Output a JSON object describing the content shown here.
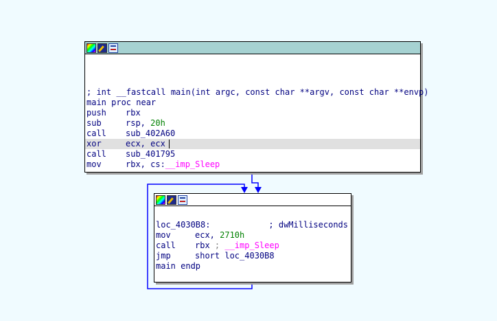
{
  "colors": {
    "background": "#f0fbff",
    "header_selected": "#a6d2d2",
    "edge": "#0000ff",
    "register": "#000080",
    "number": "#008000",
    "import": "#ff00ff",
    "comment": "#808080",
    "highlight": "#e0e0e0"
  },
  "header_icons": [
    "color-picker-icon",
    "rename-pencil-icon",
    "graph-overview-icon"
  ],
  "node_main": {
    "prototype": "; int __fastcall main(int argc, const char **argv, const char **envp)",
    "proc_line": "main proc near",
    "instructions": [
      {
        "mnemonic": "push",
        "operand": "rbx"
      },
      {
        "mnemonic": "sub",
        "operand": "rsp, ",
        "number": "20h"
      },
      {
        "mnemonic": "call",
        "operand": "sub_402A60"
      },
      {
        "mnemonic": "xor",
        "operand": "ecx, ecx"
      },
      {
        "mnemonic": "call",
        "operand": "sub_401795"
      },
      {
        "mnemonic": "mov",
        "operand": "rbx, cs:",
        "import": "__imp_Sleep"
      }
    ]
  },
  "node_loop": {
    "label": "loc_4030B8:",
    "label_comment": "; dwMilliseconds",
    "instructions": [
      {
        "mnemonic": "mov",
        "operand": "ecx, ",
        "number": "2710h"
      },
      {
        "mnemonic": "call",
        "operand": "rbx ",
        "comment": "; ",
        "import": "__imp_Sleep"
      },
      {
        "mnemonic": "jmp",
        "operand": "short loc_4030B8"
      }
    ],
    "endp_line": "main endp"
  }
}
